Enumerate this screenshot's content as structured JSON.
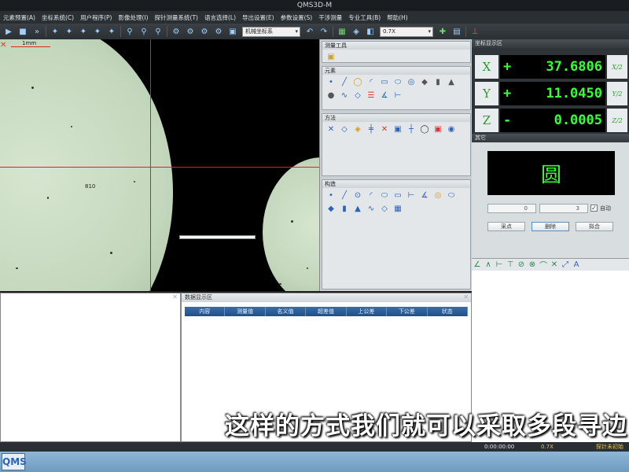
{
  "app": {
    "title": "QMS3D-M"
  },
  "menu": [
    "元素预置(A)",
    "坐标系统(C)",
    "用户程序(P)",
    "影像处理(I)",
    "探针测量系统(T)",
    "语言选择(L)",
    "导出设置(E)",
    "参数设置(S)",
    "干涉测量",
    "专业工具(B)",
    "帮助(H)"
  ],
  "toolbar": {
    "coord_system": "机械坐标系",
    "zoom": "0.7X"
  },
  "viewport": {
    "scale_label": "1mm",
    "center_label": "810"
  },
  "tools_panel": {
    "measure_tools": {
      "title": "测量工具"
    },
    "elements": {
      "title": "元素"
    },
    "methods": {
      "title": "方法"
    },
    "construct": {
      "title": "构造"
    }
  },
  "coords": {
    "title": "坐标显示区",
    "rows": [
      {
        "axis": "X",
        "sign": "+",
        "value": "37.6806",
        "half": "X/2"
      },
      {
        "axis": "Y",
        "sign": "+",
        "value": "11.0450",
        "half": "Y/2"
      },
      {
        "axis": "Z",
        "sign": "-",
        "value": "0.0005",
        "half": "Z/2"
      }
    ]
  },
  "other": {
    "title": "其它",
    "shape": "圆",
    "spin1": "0",
    "spin2": "3",
    "auto_label": "自动",
    "btn_sample": "采点",
    "btn_delete": "删除",
    "btn_fit": "拟合"
  },
  "data_panel": {
    "title": "数据显示区",
    "columns": [
      "内容",
      "测量值",
      "名义值",
      "超差值",
      "上公差",
      "下公差",
      "状态"
    ]
  },
  "subtitle": "这样的方式我们就可以采取多段寻边",
  "status": {
    "time": "0:00:00:00",
    "zoom": "0.7X",
    "probe": "探针未初始"
  },
  "taskbar": {
    "app_icon": "QMS"
  }
}
